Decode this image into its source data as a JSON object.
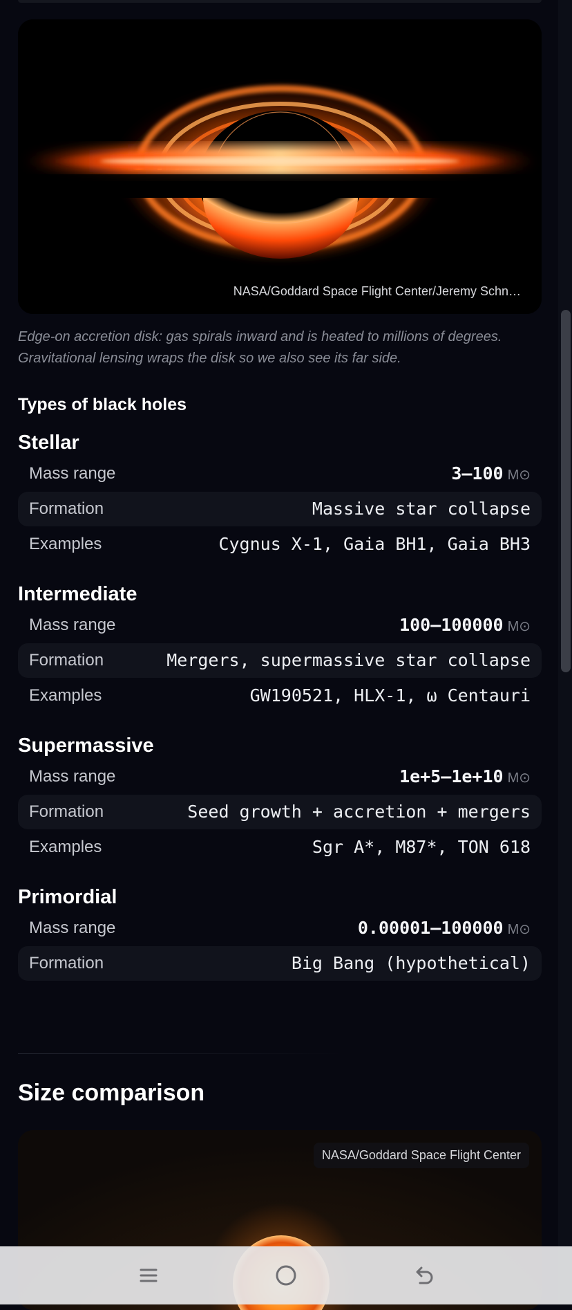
{
  "hero": {
    "credit": "NASA/Goddard Space Flight Center/Jeremy Schn…",
    "caption": "Edge-on accretion disk: gas spirals inward and is heated to millions of degrees. Gravitational lensing wraps the disk so we also see its far side."
  },
  "types": {
    "title": "Types of black holes",
    "unit": "M⊙",
    "groups": [
      {
        "name": "Stellar",
        "rows": [
          {
            "label": "Mass range",
            "value": "3–100"
          },
          {
            "label": "Formation",
            "value": "Massive star collapse"
          },
          {
            "label": "Examples",
            "value": "Cygnus X-1, Gaia BH1, Gaia BH3"
          }
        ]
      },
      {
        "name": "Intermediate",
        "rows": [
          {
            "label": "Mass range",
            "value": "100–100000"
          },
          {
            "label": "Formation",
            "value": "Mergers, supermassive star collapse"
          },
          {
            "label": "Examples",
            "value": "GW190521, HLX-1, ω Centauri"
          }
        ]
      },
      {
        "name": "Supermassive",
        "rows": [
          {
            "label": "Mass range",
            "value": "1e+5–1e+10"
          },
          {
            "label": "Formation",
            "value": "Seed growth + accretion + mergers"
          },
          {
            "label": "Examples",
            "value": "Sgr A*, M87*, TON 618"
          }
        ]
      },
      {
        "name": "Primordial",
        "rows": [
          {
            "label": "Mass range",
            "value": "0.00001–100000"
          },
          {
            "label": "Formation",
            "value": "Big Bang (hypothetical)"
          }
        ]
      }
    ]
  },
  "size_comparison": {
    "title": "Size comparison",
    "credit": "NASA/Goddard Space Flight Center"
  },
  "navbar": {
    "icons": [
      "menu-icon",
      "home-icon",
      "back-icon"
    ]
  }
}
